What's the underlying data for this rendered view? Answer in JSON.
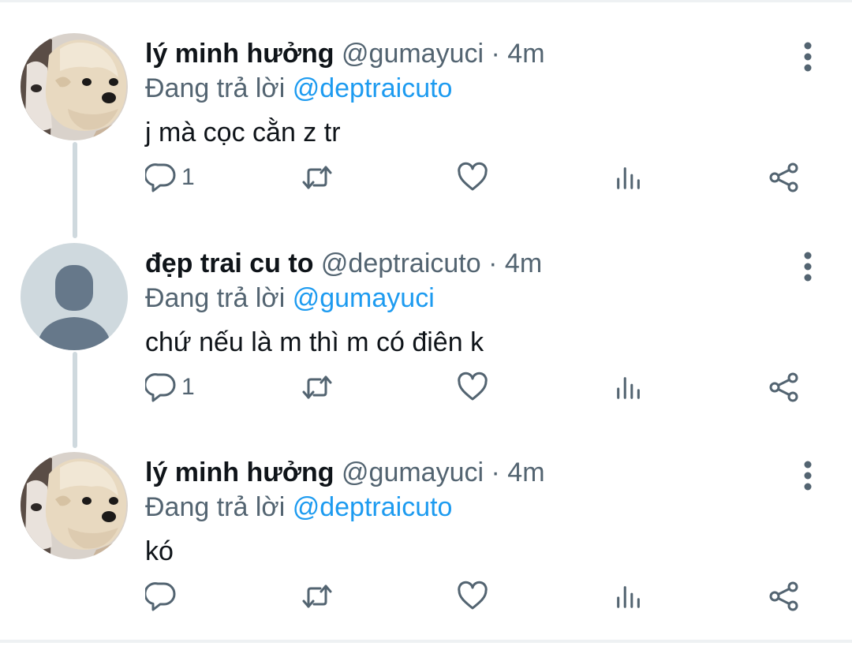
{
  "tweets": [
    {
      "name": "lý minh hưởng",
      "handle": "@gumayuci",
      "sep": "·",
      "time": "4m",
      "replying_prefix": "Đang trả lời",
      "replying_to": "@deptraicuto",
      "text": "j mà cọc cằn z tr",
      "reply_count": "1",
      "avatar": "dog-photo-avatar"
    },
    {
      "name": "đẹp trai cu to",
      "handle": "@deptraicuto",
      "sep": "·",
      "time": "4m",
      "replying_prefix": "Đang trả lời",
      "replying_to": "@gumayuci",
      "text": "chứ nếu là m thì m có điên k",
      "reply_count": "1",
      "avatar": "default-profile-avatar"
    },
    {
      "name": "lý minh hưởng",
      "handle": "@gumayuci",
      "sep": "·",
      "time": "4m",
      "replying_prefix": "Đang trả lời",
      "replying_to": "@deptraicuto",
      "text": "kó",
      "reply_count": "",
      "avatar": "dog-photo-avatar"
    }
  ],
  "icons": {
    "reply": "reply-icon",
    "retweet": "retweet-icon",
    "like": "heart-icon",
    "analytics": "analytics-icon",
    "share": "share-icon",
    "more": "more-vertical-icon"
  },
  "colors": {
    "text": "#0f1419",
    "secondary": "#536471",
    "mention": "#1d9bf0",
    "thread_line": "#cfd9de",
    "default_avatar_bg": "#cfd9de",
    "default_avatar_fg": "#66788a"
  }
}
